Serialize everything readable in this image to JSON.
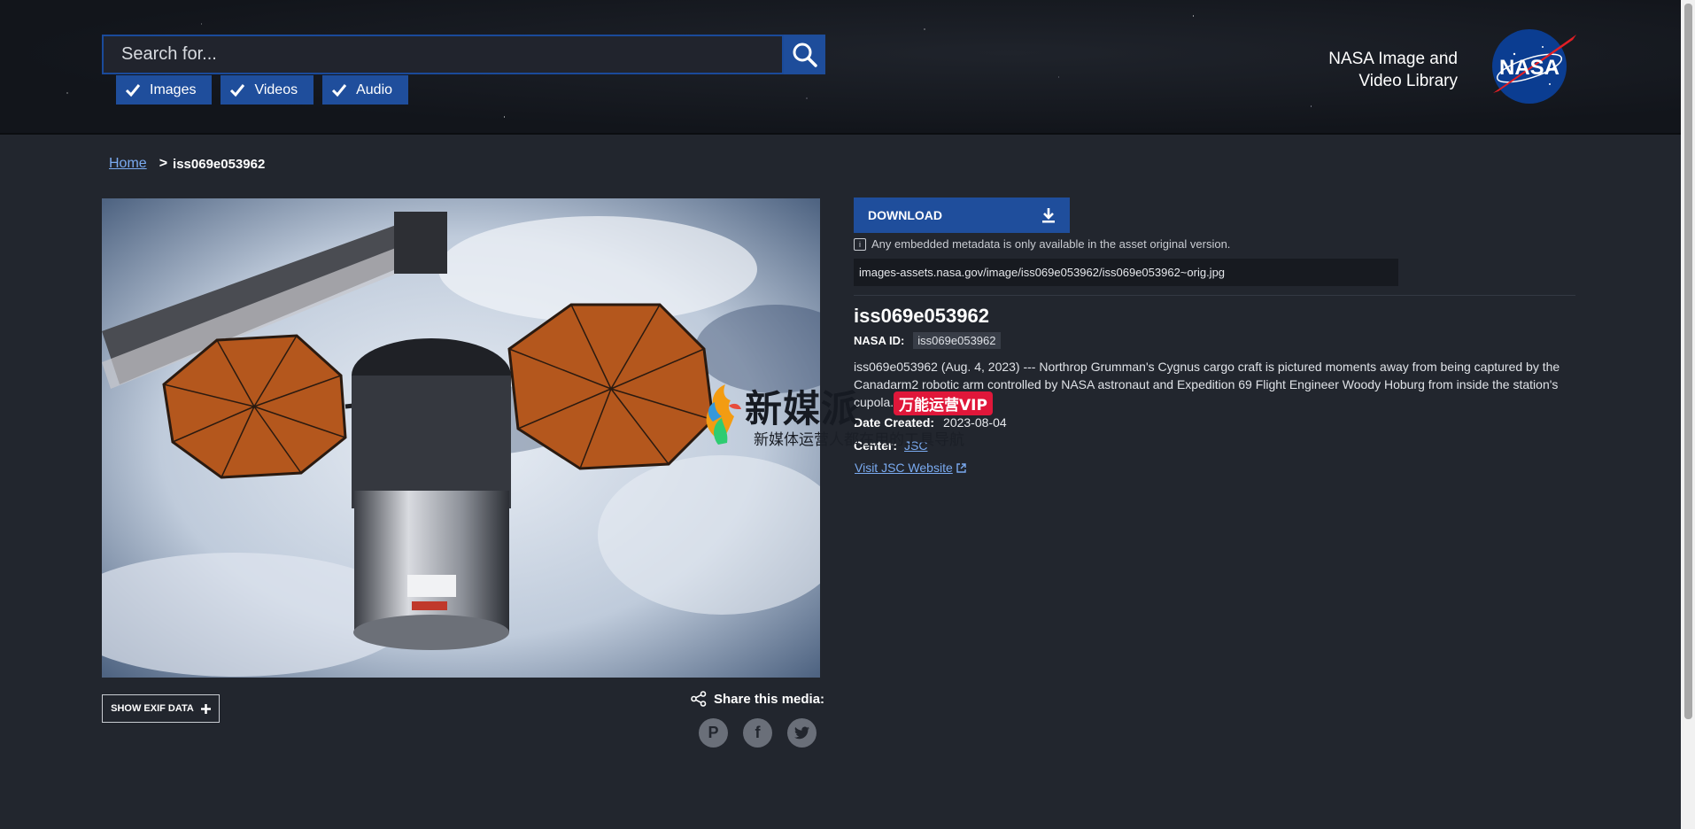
{
  "header": {
    "search_placeholder": "Search for...",
    "filters": [
      {
        "label": "Images",
        "checked": true
      },
      {
        "label": "Videos",
        "checked": true
      },
      {
        "label": "Audio",
        "checked": true
      }
    ],
    "brand_line1": "NASA Image and",
    "brand_line2": "Video Library",
    "logo_text": "NASA"
  },
  "breadcrumb": {
    "home": "Home",
    "separator": ">",
    "current": "iss069e053962"
  },
  "media": {
    "exif_button": "SHOW EXIF DATA",
    "share_label": "Share this media:",
    "share_icons": [
      "pinterest-icon",
      "facebook-icon",
      "twitter-icon"
    ]
  },
  "asset": {
    "download_label": "DOWNLOAD",
    "metadata_note": "Any embedded metadata is only available in the asset original version.",
    "url": "images-assets.nasa.gov/image/iss069e053962/iss069e053962~orig.jpg",
    "title": "iss069e053962",
    "nasa_id_label": "NASA ID:",
    "nasa_id": "iss069e053962",
    "description": "iss069e053962 (Aug. 4, 2023) --- Northrop Grumman's Cygnus cargo craft is pictured moments away from being captured by the Canadarm2 robotic arm controlled by NASA astronaut and Expedition 69 Flight Engineer Woody Hoburg from inside the station's cupola.",
    "date_label": "Date Created:",
    "date": "2023-08-04",
    "center_label": "Center:",
    "center": "JSC",
    "visit_link": "Visit JSC Website"
  },
  "watermark": {
    "main": "新媒派",
    "badge": "万能运营VIP",
    "sub": "新媒体运营人都在用的工具导航"
  },
  "colors": {
    "accent": "#1f4e9c",
    "link": "#7aaaf0",
    "background": "#22262e"
  }
}
